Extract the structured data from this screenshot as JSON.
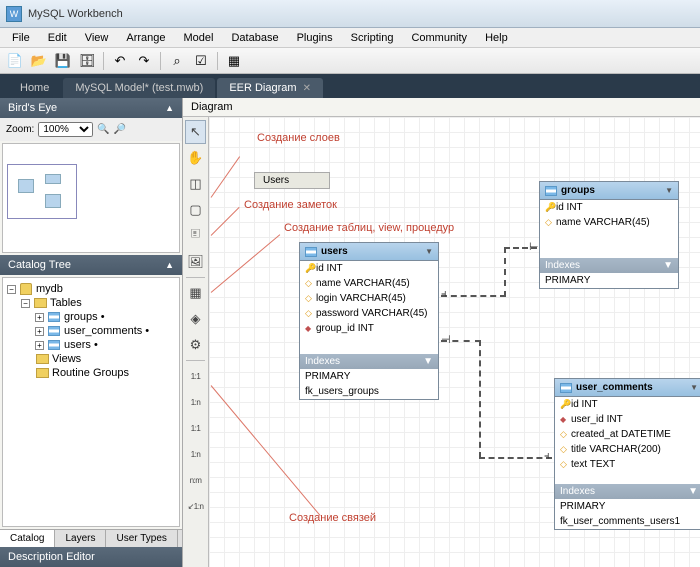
{
  "titlebar": {
    "title": "MySQL Workbench"
  },
  "menubar": [
    "File",
    "Edit",
    "View",
    "Arrange",
    "Model",
    "Database",
    "Plugins",
    "Scripting",
    "Community",
    "Help"
  ],
  "nav_tabs": {
    "home": "Home",
    "model": "MySQL Model* (test.mwb)",
    "eer": "EER Diagram"
  },
  "left": {
    "birds_eye": "Bird's Eye",
    "zoom_label": "Zoom:",
    "zoom_value": "100%",
    "catalog_tree": "Catalog Tree",
    "tree": {
      "db": "mydb",
      "tables": "Tables",
      "items": [
        "groups •",
        "user_comments •",
        "users •"
      ],
      "views": "Views",
      "routines": "Routine Groups"
    },
    "bottom_tabs": [
      "Catalog",
      "Layers",
      "User Types"
    ],
    "desc_editor": "Description Editor"
  },
  "canvas": {
    "diagram_label": "Diagram",
    "layer_tab": "Users",
    "annotations": {
      "layers": "Создание слоев",
      "notes": "Создание заметок",
      "tables": "Создание таблиц, view, процедур",
      "relations": "Создание связей"
    },
    "tables": {
      "users": {
        "name": "users",
        "cols": [
          {
            "k": "pk",
            "t": "id INT"
          },
          {
            "k": "",
            "t": "name VARCHAR(45)"
          },
          {
            "k": "",
            "t": "login VARCHAR(45)"
          },
          {
            "k": "",
            "t": "password VARCHAR(45)"
          },
          {
            "k": "fk",
            "t": "group_id INT"
          }
        ],
        "idx_label": "Indexes",
        "idx": [
          "PRIMARY",
          "fk_users_groups"
        ]
      },
      "groups": {
        "name": "groups",
        "cols": [
          {
            "k": "pk",
            "t": "id INT"
          },
          {
            "k": "",
            "t": "name VARCHAR(45)"
          }
        ],
        "idx_label": "Indexes",
        "idx": [
          "PRIMARY"
        ]
      },
      "user_comments": {
        "name": "user_comments",
        "cols": [
          {
            "k": "pk",
            "t": "id INT"
          },
          {
            "k": "fk",
            "t": "user_id INT"
          },
          {
            "k": "",
            "t": "created_at DATETIME"
          },
          {
            "k": "",
            "t": "title VARCHAR(200)"
          },
          {
            "k": "",
            "t": "text TEXT"
          }
        ],
        "idx_label": "Indexes",
        "idx": [
          "PRIMARY",
          "fk_user_comments_users1"
        ]
      }
    }
  }
}
